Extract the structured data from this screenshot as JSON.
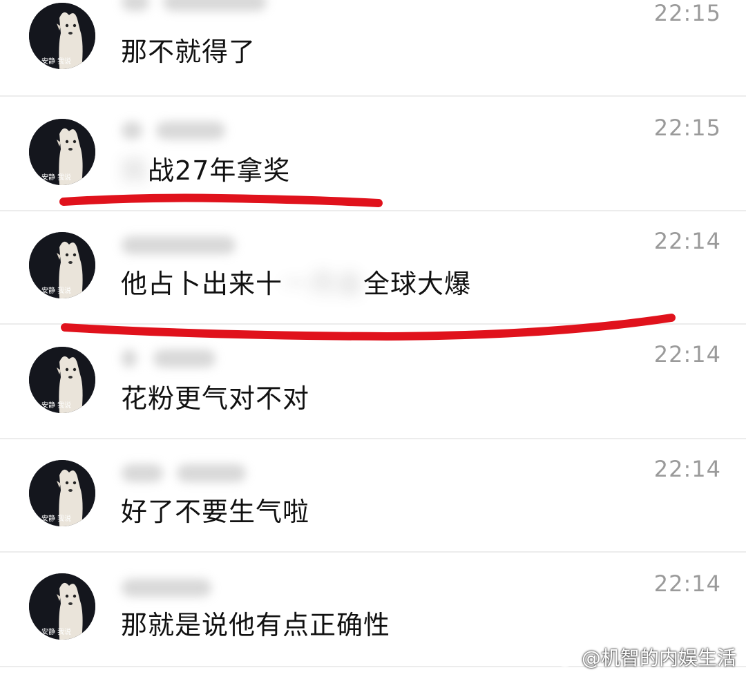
{
  "messages": [
    {
      "time": "22:15",
      "text": "那不就得了"
    },
    {
      "time": "22:15",
      "text_visible": "战27年拿奖"
    },
    {
      "time": "22:14",
      "text_before": "他占卜出来十",
      "text_after": "全球大爆"
    },
    {
      "time": "22:14",
      "text": "花粉更气对不对"
    },
    {
      "time": "22:14",
      "text": "好了不要生气啦"
    },
    {
      "time": "22:14",
      "text": "那就是说他有点正确性"
    }
  ],
  "avatar": {
    "caption": "安静 我说"
  },
  "watermark": {
    "text": "@机智的内娱生活",
    "icon": "weibo-icon"
  },
  "colors": {
    "annotation": "#e0121c",
    "time": "#9a9a9a",
    "divider": "#ececec"
  }
}
